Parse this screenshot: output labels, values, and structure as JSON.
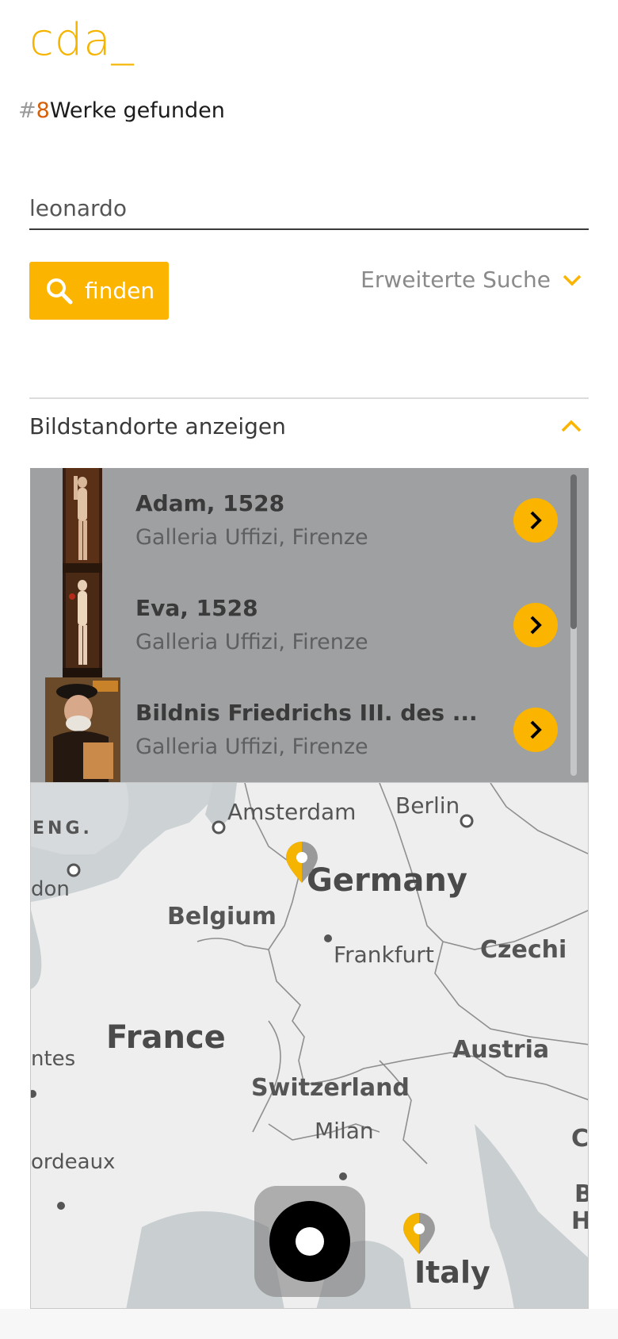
{
  "app": {
    "logo": "cda_"
  },
  "results_count": {
    "hash": "#",
    "number": "8",
    "label": "Werke gefunden"
  },
  "search": {
    "value": "leonardo",
    "button_label": "finden"
  },
  "advanced_search": {
    "label": "Erweiterte Suche"
  },
  "locations": {
    "label": "Bildstandorte anzeigen"
  },
  "results": [
    {
      "title": "Adam, 1528",
      "location": "Galleria Uffizi, Firenze"
    },
    {
      "title": "Eva, 1528",
      "location": "Galleria Uffizi, Firenze"
    },
    {
      "title": "Bildnis Friedrichs III. des ...",
      "location": "Galleria Uffizi, Firenze"
    }
  ],
  "map": {
    "labels": {
      "amsterdam": "Amsterdam",
      "berlin": "Berlin",
      "eng": "ENG.",
      "london": "don",
      "germany": "Germany",
      "belgium": "Belgium",
      "frankfurt": "Frankfurt",
      "czech": "Czechi",
      "france": "France",
      "nantes": "ntes",
      "austria": "Austria",
      "switzerland": "Switzerland",
      "milan": "Milan",
      "croatia": "Cr",
      "bordeaux": "ordeaux",
      "bh": "B",
      "bh2": "H",
      "italy": "Italy"
    }
  },
  "colors": {
    "accent": "#fbb400",
    "count": "#d4600a"
  }
}
